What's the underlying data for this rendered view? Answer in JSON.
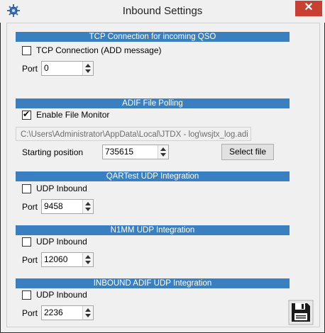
{
  "window": {
    "title": "Inbound Settings",
    "close_glyph": "✕"
  },
  "sections": [
    {
      "header": "TCP Connection for incoming QSO",
      "checkbox_label": "TCP Connection (ADD message)",
      "checked": false,
      "port_label": "Port",
      "port_value": "0"
    },
    {
      "header": "ADIF File Polling",
      "checkbox_label": "Enable File Monitor",
      "checked": true,
      "file_path": "C:\\Users\\Administrator\\AppData\\Local\\JTDX - log\\wsjtx_log.adi",
      "starting_position_label": "Starting position",
      "starting_position_value": "735615",
      "select_file_label": "Select file"
    },
    {
      "header": "QARTest UDP Integration",
      "checkbox_label": "UDP Inbound",
      "checked": false,
      "port_label": "Port",
      "port_value": "9458"
    },
    {
      "header": "N1MM UDP Integration",
      "checkbox_label": "UDP Inbound",
      "checked": false,
      "port_label": "Port",
      "port_value": "12060"
    },
    {
      "header": "INBOUND ADIF UDP Integration",
      "checkbox_label": "UDP Inbound",
      "checked": false,
      "port_label": "Port",
      "port_value": "2236"
    }
  ],
  "icons": {
    "app": "gear-bug-icon",
    "save": "floppy-disk-icon"
  },
  "colors": {
    "section_header_bg": "#3a7fc0",
    "close_button_bg": "#c84031"
  }
}
